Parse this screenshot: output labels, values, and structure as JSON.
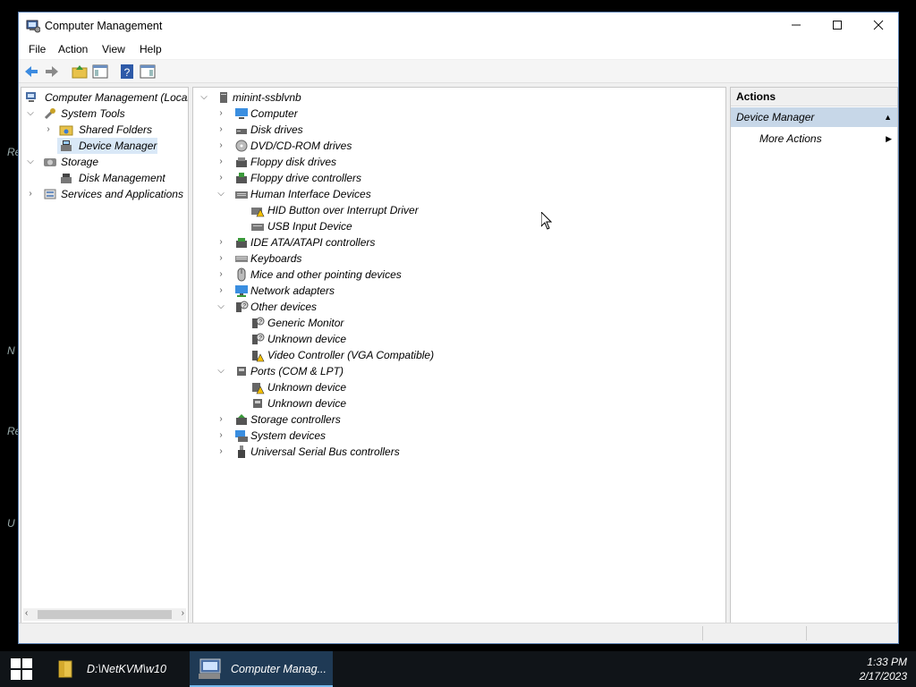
{
  "window": {
    "title": "Computer Management"
  },
  "menu": [
    "File",
    "Action",
    "View",
    "Help"
  ],
  "left_tree": {
    "root": "Computer Management (Local)",
    "system_tools": "System Tools",
    "shared_folders": "Shared Folders",
    "device_manager": "Device Manager",
    "storage": "Storage",
    "disk_management": "Disk Management",
    "services": "Services and Applications"
  },
  "device_tree": {
    "root": "minint-ssblvnb",
    "items": [
      "Computer",
      "Disk drives",
      "DVD/CD-ROM drives",
      "Floppy disk drives",
      "Floppy drive controllers",
      "Human Interface Devices",
      "HID Button over Interrupt Driver",
      "USB Input Device",
      "IDE ATA/ATAPI controllers",
      "Keyboards",
      "Mice and other pointing devices",
      "Network adapters",
      "Other devices",
      "Generic Monitor",
      "Unknown device",
      "Video Controller (VGA Compatible)",
      "Ports (COM & LPT)",
      "Unknown device",
      "Unknown device",
      "Storage controllers",
      "System devices",
      "Universal Serial Bus controllers"
    ]
  },
  "actions": {
    "header": "Actions",
    "section": "Device Manager",
    "more": "More Actions"
  },
  "taskbar": {
    "explorer_label": "D:\\NetKVM\\w10",
    "compmgmt_label": "Computer Manag...",
    "time": "1:33 PM",
    "date": "2/17/2023"
  },
  "desktop_glyphs": [
    "Re",
    "N",
    "Re",
    "U"
  ]
}
